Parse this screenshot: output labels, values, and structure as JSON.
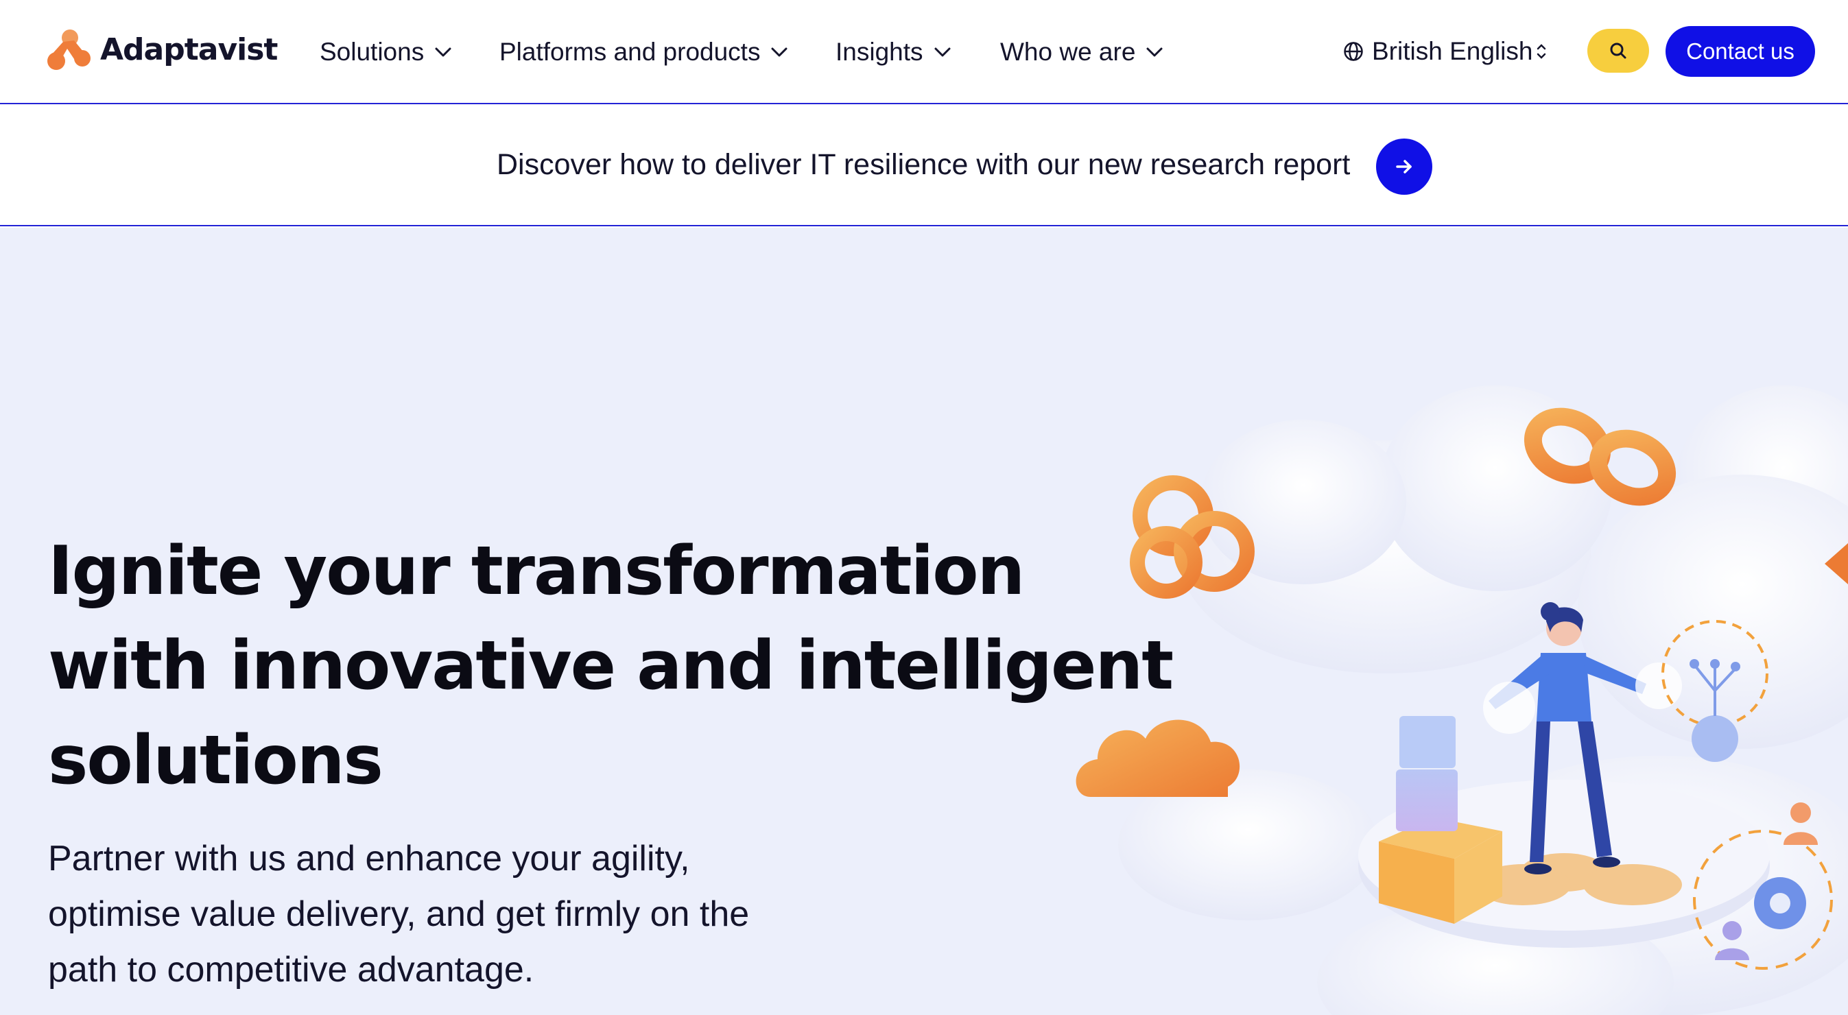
{
  "brand": {
    "name": "Adaptavist",
    "colors": {
      "orange": "#ef7d3a",
      "blue": "#1010e6",
      "yellow": "#f7ce3e",
      "hero_bg": "#eceffb"
    }
  },
  "nav": {
    "items": [
      {
        "label": "Solutions",
        "icon": "chevron-down-icon"
      },
      {
        "label": "Platforms and products",
        "icon": "chevron-down-icon"
      },
      {
        "label": "Insights",
        "icon": "chevron-down-icon"
      },
      {
        "label": "Who we are",
        "icon": "chevron-down-icon"
      }
    ],
    "language": {
      "selected": "British English",
      "icon": "globe-icon"
    },
    "search_icon": "search-icon",
    "contact_label": "Contact us"
  },
  "banner": {
    "text": "Discover how to deliver IT resilience with our new research report",
    "icon": "arrow-right-icon"
  },
  "hero": {
    "title_lines": [
      "Ignite your transformation",
      "with innovative and intelligent",
      "solutions"
    ],
    "subtitle_lines": [
      "Partner with us and enhance your agility,",
      "optimise value delivery, and get firmly on the",
      "path to competitive advantage."
    ]
  }
}
